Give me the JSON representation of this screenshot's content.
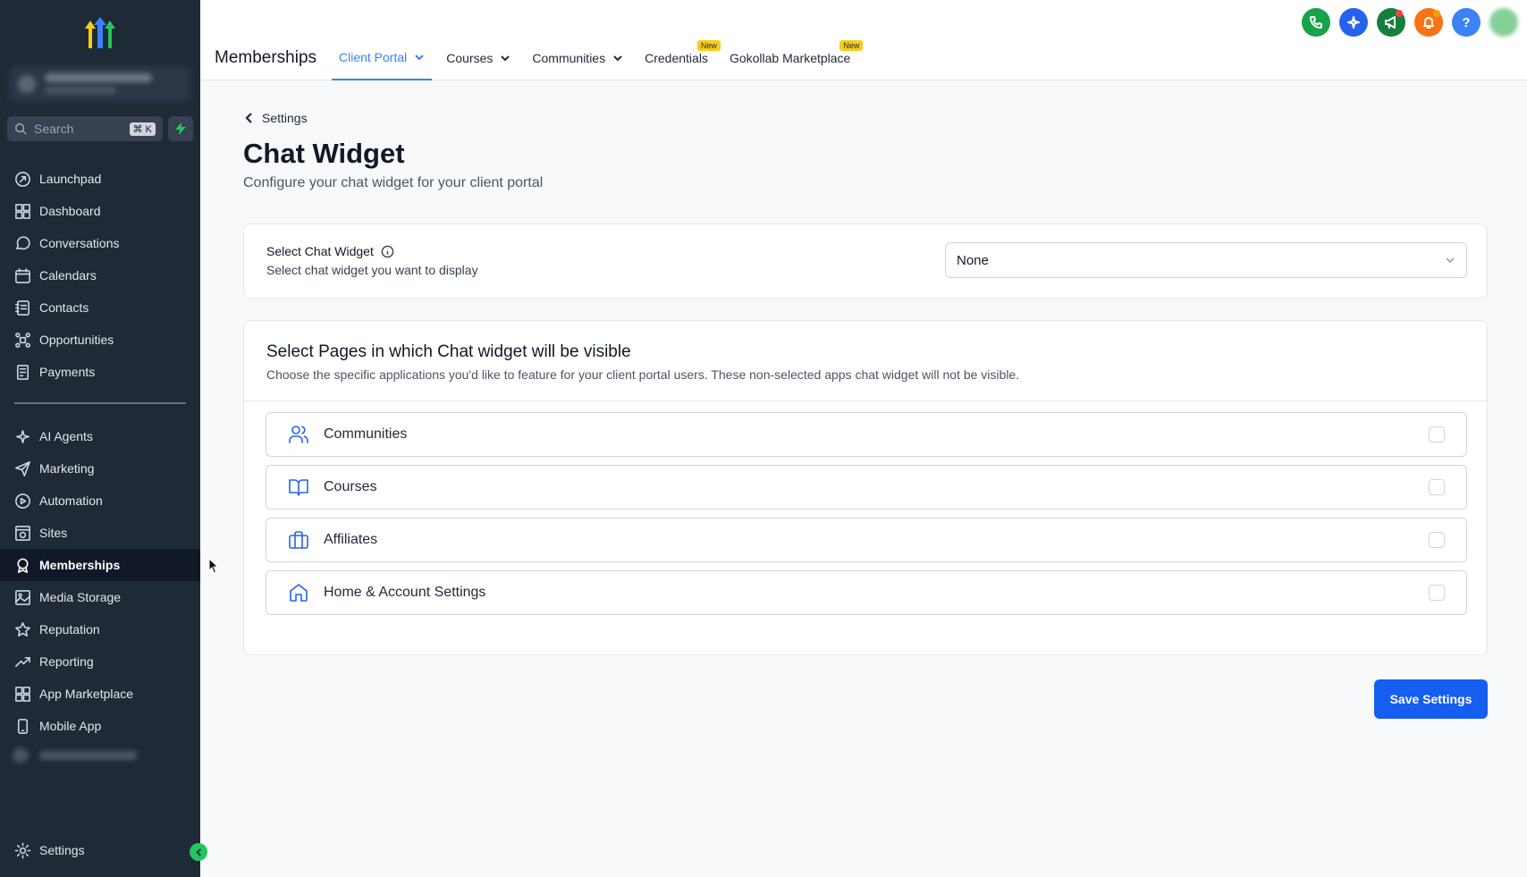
{
  "sidebar": {
    "search_placeholder": "Search",
    "search_shortcut": "⌘ K",
    "nav_primary": [
      {
        "label": "Launchpad",
        "icon": "launchpad-icon"
      },
      {
        "label": "Dashboard",
        "icon": "dashboard-icon"
      },
      {
        "label": "Conversations",
        "icon": "conversations-icon"
      },
      {
        "label": "Calendars",
        "icon": "calendar-icon"
      },
      {
        "label": "Contacts",
        "icon": "contacts-icon"
      },
      {
        "label": "Opportunities",
        "icon": "opportunities-icon"
      },
      {
        "label": "Payments",
        "icon": "payments-icon"
      }
    ],
    "nav_secondary": [
      {
        "label": "AI Agents",
        "icon": "ai-agents-icon"
      },
      {
        "label": "Marketing",
        "icon": "marketing-icon"
      },
      {
        "label": "Automation",
        "icon": "automation-icon"
      },
      {
        "label": "Sites",
        "icon": "sites-icon"
      },
      {
        "label": "Memberships",
        "icon": "memberships-icon",
        "active": true
      },
      {
        "label": "Media Storage",
        "icon": "media-storage-icon"
      },
      {
        "label": "Reputation",
        "icon": "reputation-icon"
      },
      {
        "label": "Reporting",
        "icon": "reporting-icon"
      },
      {
        "label": "App Marketplace",
        "icon": "app-marketplace-icon"
      },
      {
        "label": "Mobile App",
        "icon": "mobile-app-icon"
      }
    ],
    "settings_label": "Settings"
  },
  "topbar": {
    "app_title": "Memberships",
    "tabs": [
      {
        "label": "Client Portal",
        "dropdown": true,
        "active": true
      },
      {
        "label": "Courses",
        "dropdown": true
      },
      {
        "label": "Communities",
        "dropdown": true
      },
      {
        "label": "Credentials",
        "badge": "New"
      },
      {
        "label": "Gokollab Marketplace",
        "badge": "New"
      }
    ],
    "action_colors": {
      "phone": "#16a34a",
      "ai": "#2563eb",
      "announce": "#15803d",
      "notify": "#f97316",
      "help": "#3b82f6"
    }
  },
  "main": {
    "breadcrumb": "Settings",
    "title": "Chat Widget",
    "subtitle": "Configure your chat widget for your client portal",
    "widget_select": {
      "label": "Select Chat Widget",
      "description": "Select chat widget you want to display",
      "value": "None"
    },
    "pages": {
      "title": "Select Pages in which Chat widget will be visible",
      "description": "Choose the specific applications you'd like to feature for your client portal users. These non-selected apps chat widget will not be visible.",
      "options": [
        {
          "label": "Communities",
          "icon": "users-icon",
          "checked": false
        },
        {
          "label": "Courses",
          "icon": "book-icon",
          "checked": false
        },
        {
          "label": "Affiliates",
          "icon": "briefcase-icon",
          "checked": false
        },
        {
          "label": "Home & Account Settings",
          "icon": "home-icon",
          "checked": false
        }
      ]
    },
    "save_label": "Save Settings"
  },
  "colors": {
    "sidebar_bg": "#1f2a37",
    "accent": "#155eef",
    "active_tab": "#3b82f6"
  }
}
